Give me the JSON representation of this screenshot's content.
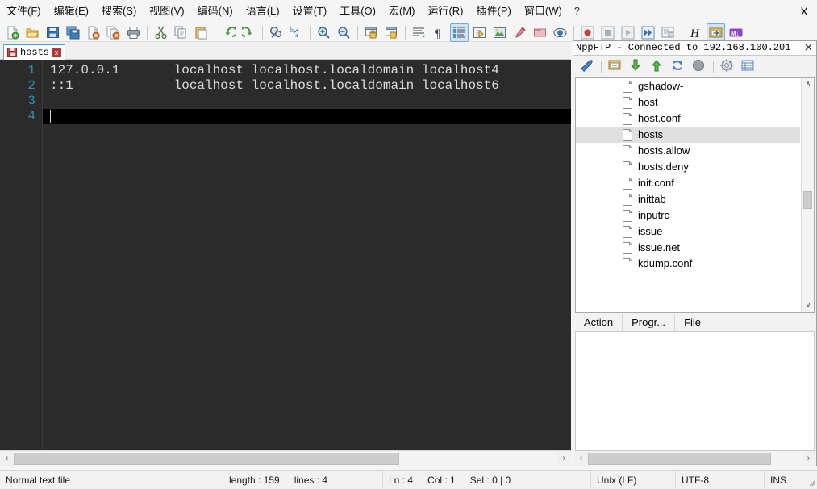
{
  "window": {
    "close_label": "X"
  },
  "menubar": {
    "items": [
      {
        "label": "文件(F)",
        "name": "menu-file"
      },
      {
        "label": "编辑(E)",
        "name": "menu-edit"
      },
      {
        "label": "搜索(S)",
        "name": "menu-search"
      },
      {
        "label": "视图(V)",
        "name": "menu-view"
      },
      {
        "label": "编码(N)",
        "name": "menu-encoding"
      },
      {
        "label": "语言(L)",
        "name": "menu-language"
      },
      {
        "label": "设置(T)",
        "name": "menu-settings"
      },
      {
        "label": "工具(O)",
        "name": "menu-tools"
      },
      {
        "label": "宏(M)",
        "name": "menu-macro"
      },
      {
        "label": "运行(R)",
        "name": "menu-run"
      },
      {
        "label": "插件(P)",
        "name": "menu-plugins"
      },
      {
        "label": "窗口(W)",
        "name": "menu-window"
      },
      {
        "label": "?",
        "name": "menu-help"
      }
    ]
  },
  "toolbar": {
    "icons": [
      "new-file-icon",
      "open-file-icon",
      "save-icon",
      "save-all-icon",
      "close-file-icon",
      "close-all-icon",
      "print-icon",
      "sep",
      "cut-icon",
      "copy-icon",
      "paste-icon",
      "sep",
      "undo-icon",
      "redo-icon",
      "sep",
      "find-icon",
      "replace-icon",
      "sep",
      "zoom-in-icon",
      "zoom-out-icon",
      "sep",
      "sync-vertical-icon",
      "sync-horizontal-icon",
      "sep",
      "word-wrap-icon",
      "show-all-chars-icon",
      "indent-guide-icon",
      "ui-show-icon",
      "user-defined-language-icon",
      "document-map-icon",
      "function-list-icon",
      "folder-as-workspace-icon",
      "monitoring-icon",
      "sep",
      "record-macro-icon",
      "stop-record-macro-icon",
      "playback-macro-icon",
      "run-macro-multiple-icon",
      "save-macro-icon",
      "sep",
      "html-tag-icon",
      "npp-ftp-icon",
      "markdown-icon"
    ]
  },
  "tab": {
    "label": "hosts",
    "close_label": "x",
    "modified": true
  },
  "editor": {
    "lines": [
      {
        "number": "1",
        "text": "127.0.0.1       localhost localhost.localdomain localhost4"
      },
      {
        "number": "2",
        "text": "::1             localhost localhost.localdomain localhost6"
      },
      {
        "number": "3",
        "text": ""
      },
      {
        "number": "4",
        "text": ""
      }
    ],
    "current_line": 4,
    "background": "#2b2b2b",
    "current_line_bg": "#000000",
    "text_color": "#dcdcdc",
    "line_number_color": "#2b91af"
  },
  "ftp_panel": {
    "title": "NppFTP - Connected to 192.168.100.201",
    "close_label": "x",
    "toolbar_icons": [
      "connect-icon",
      "sep",
      "open-dir-icon",
      "download-icon",
      "upload-icon",
      "refresh-icon",
      "abort-icon",
      "sep",
      "settings-icon",
      "messages-icon"
    ],
    "files": [
      {
        "name": "gshadow-",
        "selected": false
      },
      {
        "name": "host",
        "selected": false
      },
      {
        "name": "host.conf",
        "selected": false
      },
      {
        "name": "hosts",
        "selected": true
      },
      {
        "name": "hosts.allow",
        "selected": false
      },
      {
        "name": "hosts.deny",
        "selected": false
      },
      {
        "name": "init.conf",
        "selected": false
      },
      {
        "name": "inittab",
        "selected": false
      },
      {
        "name": "inputrc",
        "selected": false
      },
      {
        "name": "issue",
        "selected": false
      },
      {
        "name": "issue.net",
        "selected": false
      },
      {
        "name": "kdump.conf",
        "selected": false
      }
    ],
    "tabs": [
      {
        "label": "Action",
        "name": "ftp-tab-action"
      },
      {
        "label": "Progr...",
        "name": "ftp-tab-progress"
      },
      {
        "label": "File",
        "name": "ftp-tab-file"
      }
    ],
    "scroll_up_glyph": "∧",
    "scroll_down_glyph": "∨"
  },
  "statusbar": {
    "file_type": "Normal text file",
    "length_label": "length : 159",
    "lines_label": "lines : 4",
    "ln_label": "Ln : 4",
    "col_label": "Col : 1",
    "sel_label": "Sel : 0 | 0",
    "eol": "Unix (LF)",
    "encoding": "UTF-8",
    "insert_mode": "INS"
  },
  "scrollbars": {
    "left_arrow": "‹",
    "right_arrow": "›"
  }
}
